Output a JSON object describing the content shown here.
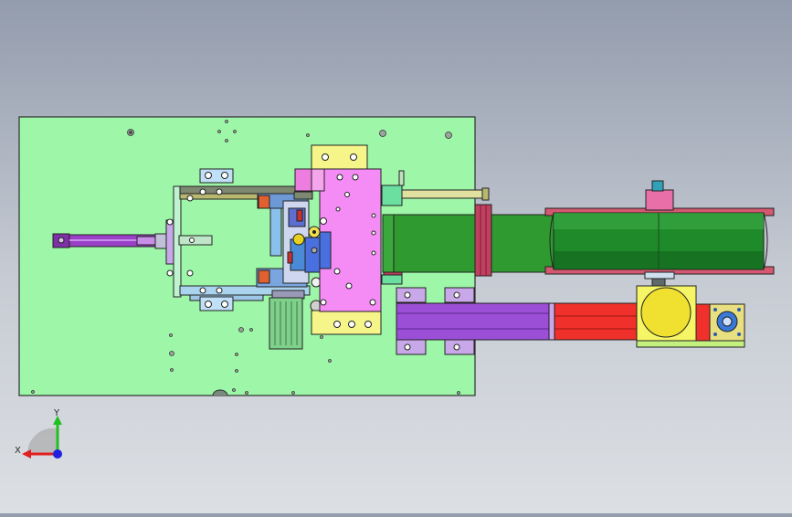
{
  "viewport": {
    "background_top": "#939cad",
    "background_bottom": "#dcdfe3"
  },
  "colors": {
    "plate": "#9ef7a8",
    "magenta_plate": "#f58cf5",
    "yellow_block": "#f5f58a",
    "conveyor_green": "#2f9a2f",
    "purple_rail": "#9b4fd6",
    "red_rail": "#f0302a",
    "drum_green": "#1f8a2a",
    "cylinder_purple": "#9a3fc8",
    "steel_blue": "#7aa6e0",
    "olive_bar": "#b8b870"
  },
  "triad": {
    "x_label": "X",
    "y_label": "Y",
    "x_color": "#e02020",
    "y_color": "#20c020",
    "z_color": "#2020e0",
    "icon": "coordinate-triad-icon"
  }
}
